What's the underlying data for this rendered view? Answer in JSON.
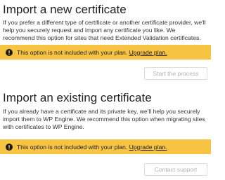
{
  "new_certificate": {
    "title": "Import a new certificate",
    "description": "If you prefer a different type of certificate or another certificate provider, we'll help you securely request and import any certificate you like. We recommend this option for sites that need Extended Validation certificates.",
    "alert_text": "This option is not included with your plan.",
    "alert_link": "Upgrade plan.",
    "button_label": "Start the process"
  },
  "existing_certificate": {
    "title": "Import an existing certificate",
    "description": "If you already have a certificate and its private key, we'll help you securely import them to WP Engine. We recommend this option when migrating sites with certificates to WP Engine.",
    "alert_text": "This option is not included with your plan.",
    "alert_link": "Upgrade plan.",
    "button_label": "Contact support"
  },
  "colors": {
    "alert_background": "#f6c343",
    "button_text_disabled": "#b5b5b5",
    "button_border": "#dcdcdc"
  },
  "icons": {
    "alert": "exclamation-circle-icon"
  }
}
